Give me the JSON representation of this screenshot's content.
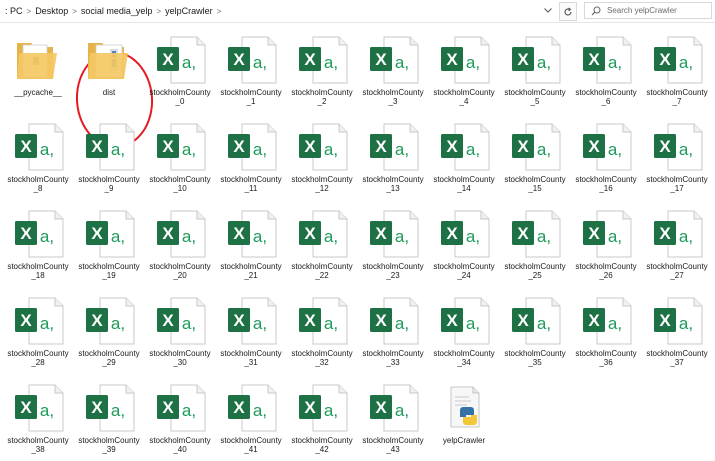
{
  "breadcrumb": {
    "segments": [
      ": PC",
      "Desktop",
      "social media_yelp",
      "yelpCrawler"
    ],
    "separator": ">"
  },
  "search": {
    "placeholder": "Search yelpCrawler"
  },
  "icons": {
    "refresh": "refresh-icon",
    "search": "search-icon",
    "dropdown": "chevron-down-icon",
    "excel": "excel-csv-icon",
    "folder": "folder-icon",
    "python": "python-file-icon"
  },
  "colors": {
    "excel_green": "#1e7145",
    "folder_yellow": "#f4c863",
    "annotation_red": "#e31b23"
  },
  "folders": [
    {
      "name": "__pycache__"
    },
    {
      "name": "dist",
      "annotated": true
    }
  ],
  "csv_files": [
    "stockholmCounty_0",
    "stockholmCounty_1",
    "stockholmCounty_2",
    "stockholmCounty_3",
    "stockholmCounty_4",
    "stockholmCounty_5",
    "stockholmCounty_6",
    "stockholmCounty_7",
    "stockholmCounty_8",
    "stockholmCounty_9",
    "stockholmCounty_10",
    "stockholmCounty_11",
    "stockholmCounty_12",
    "stockholmCounty_13",
    "stockholmCounty_14",
    "stockholmCounty_15",
    "stockholmCounty_16",
    "stockholmCounty_17",
    "stockholmCounty_18",
    "stockholmCounty_19",
    "stockholmCounty_20",
    "stockholmCounty_21",
    "stockholmCounty_22",
    "stockholmCounty_23",
    "stockholmCounty_24",
    "stockholmCounty_25",
    "stockholmCounty_26",
    "stockholmCounty_27",
    "stockholmCounty_28",
    "stockholmCounty_29",
    "stockholmCounty_30",
    "stockholmCounty_31",
    "stockholmCounty_32",
    "stockholmCounty_33",
    "stockholmCounty_34",
    "stockholmCounty_35",
    "stockholmCounty_36",
    "stockholmCounty_37",
    "stockholmCounty_38",
    "stockholmCounty_39",
    "stockholmCounty_40",
    "stockholmCounty_41",
    "stockholmCounty_42",
    "stockholmCounty_43"
  ],
  "python_files": [
    {
      "name": "yelpCrawler"
    }
  ]
}
